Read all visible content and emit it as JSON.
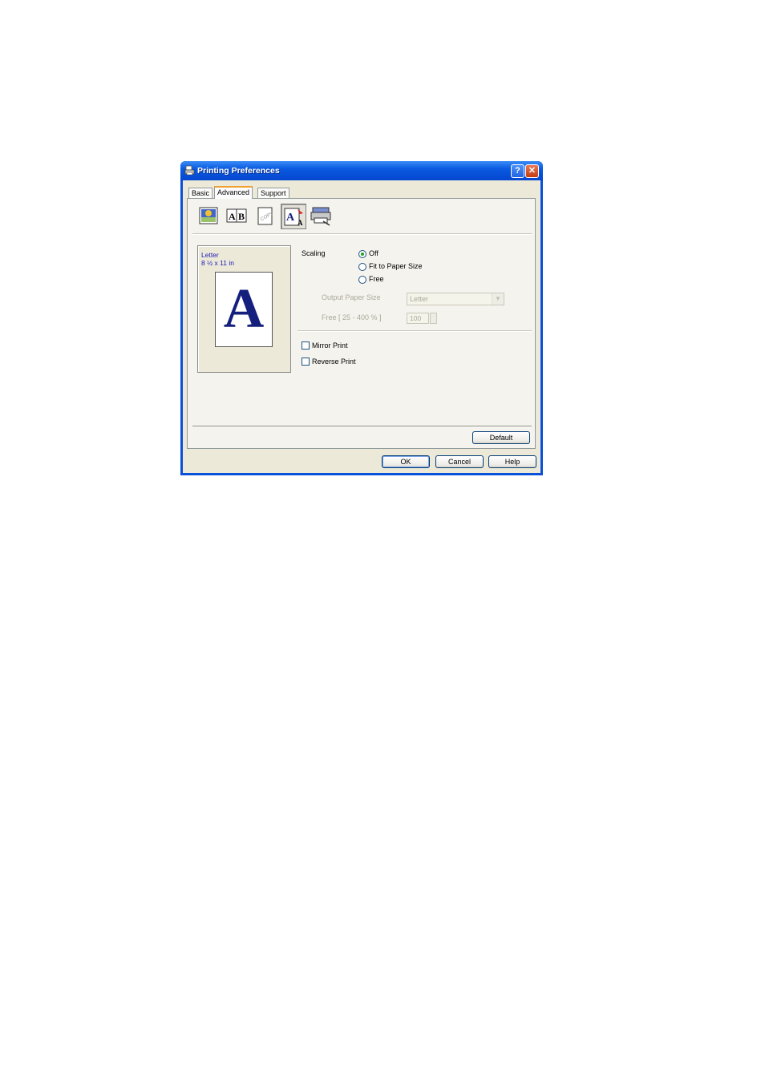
{
  "window": {
    "title": "Printing Preferences",
    "help_glyph": "?",
    "close_glyph": "✕"
  },
  "tabs": [
    {
      "label": "Basic",
      "active": false
    },
    {
      "label": "Advanced",
      "active": true
    },
    {
      "label": "Support",
      "active": false
    }
  ],
  "toolbar_icons": [
    "print-quality-icon",
    "ab-duplex-icon",
    "watermark-icon",
    "scaling-icon",
    "device-options-icon"
  ],
  "preview": {
    "paper_name": "Letter",
    "paper_dims": "8 ½ x 11 in",
    "sample_glyph": "A"
  },
  "scaling": {
    "label": "Scaling",
    "options": [
      {
        "label": "Off",
        "selected": true
      },
      {
        "label": "Fit to Paper Size",
        "selected": false
      },
      {
        "label": "Free",
        "selected": false
      }
    ],
    "output_paper_size_label": "Output Paper Size",
    "output_paper_size_value": "Letter",
    "free_label": "Free [ 25 - 400 % ]",
    "free_value": "100"
  },
  "options": [
    {
      "label": "Mirror Print",
      "checked": false
    },
    {
      "label": "Reverse Print",
      "checked": false
    }
  ],
  "buttons": {
    "default": "Default",
    "ok": "OK",
    "cancel": "Cancel",
    "help": "Help"
  }
}
